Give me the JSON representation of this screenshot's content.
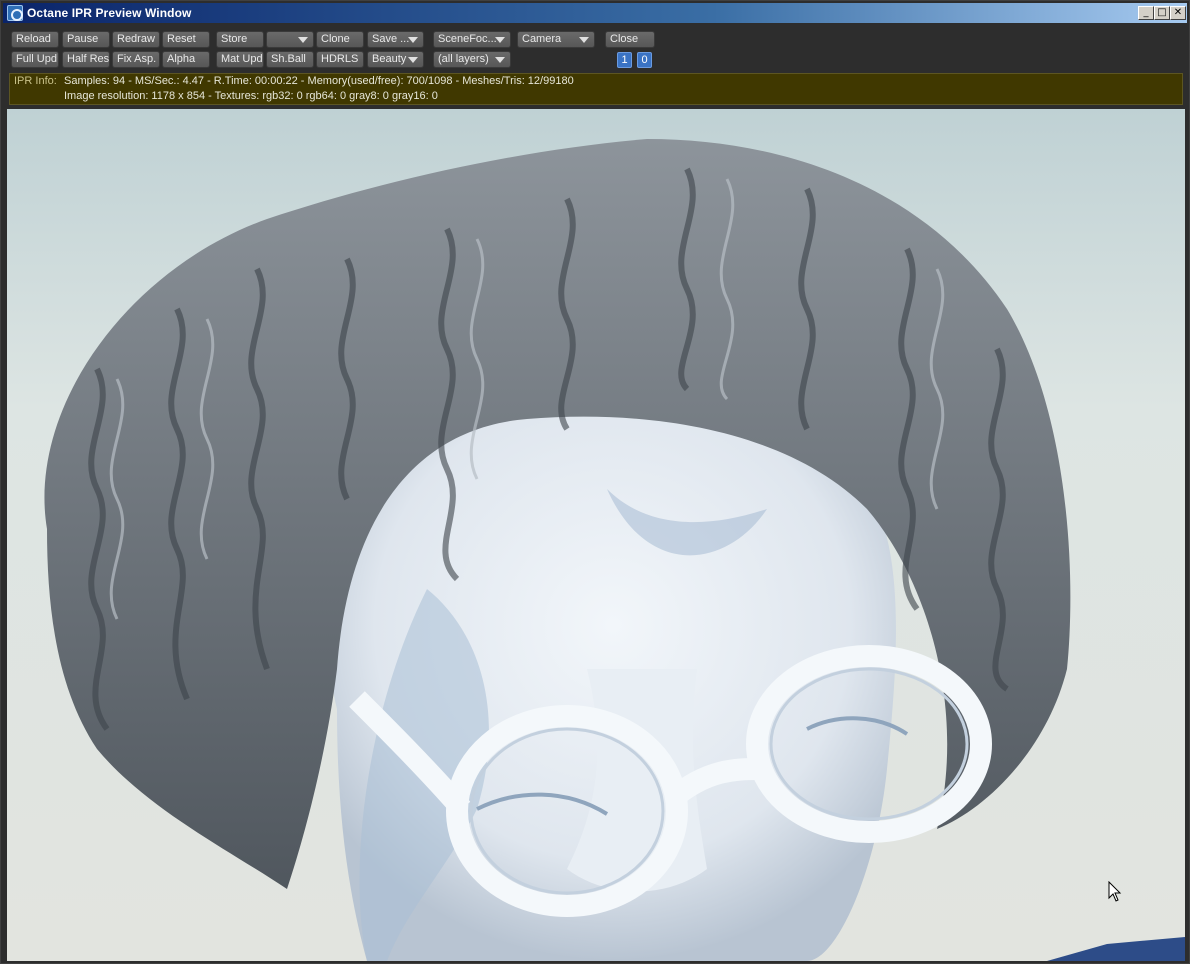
{
  "window": {
    "title": "Octane IPR Preview Window",
    "controls": {
      "minimize": "_",
      "maximize": "□",
      "close": "✕"
    }
  },
  "toolbar": {
    "row1": {
      "reload": "Reload",
      "pause": "Pause",
      "redraw": "Redraw",
      "reset": "Reset",
      "store": "Store",
      "store_select": "",
      "clone": "Clone",
      "save": "Save ...",
      "scene_focus": "SceneFoc...",
      "camera": "Camera",
      "close": "Close"
    },
    "row2": {
      "full_update": "Full Upd.",
      "half_res": "Half Res",
      "fix_aspect": "Fix Asp.",
      "alpha": "Alpha",
      "mat_update": "Mat Upd",
      "shader_ball": "Sh.Ball",
      "hdrls": "HDRLS",
      "pass": "Beauty",
      "layers": "(all layers)",
      "num_1": "1",
      "num_0": "0"
    }
  },
  "ipr_info": {
    "label": "IPR Info:",
    "line1": "Samples: 94  -  MS/Sec.: 4.47  -  R.Time: 00:00:22 - Memory(used/free): 700/1098  -  Meshes/Tris: 12/99180",
    "line2": "Image resolution: 1178 x 854 - Textures:  rgb32: 0   rgb64: 0   gray8: 0   gray16: 0"
  },
  "render": {
    "description_icon": "render-preview"
  },
  "colors": {
    "titlebar_start": "#0a246a",
    "toolbar_bg": "#2d2d2d",
    "info_bg": "#403800",
    "selected_number": "#3a73c4"
  }
}
